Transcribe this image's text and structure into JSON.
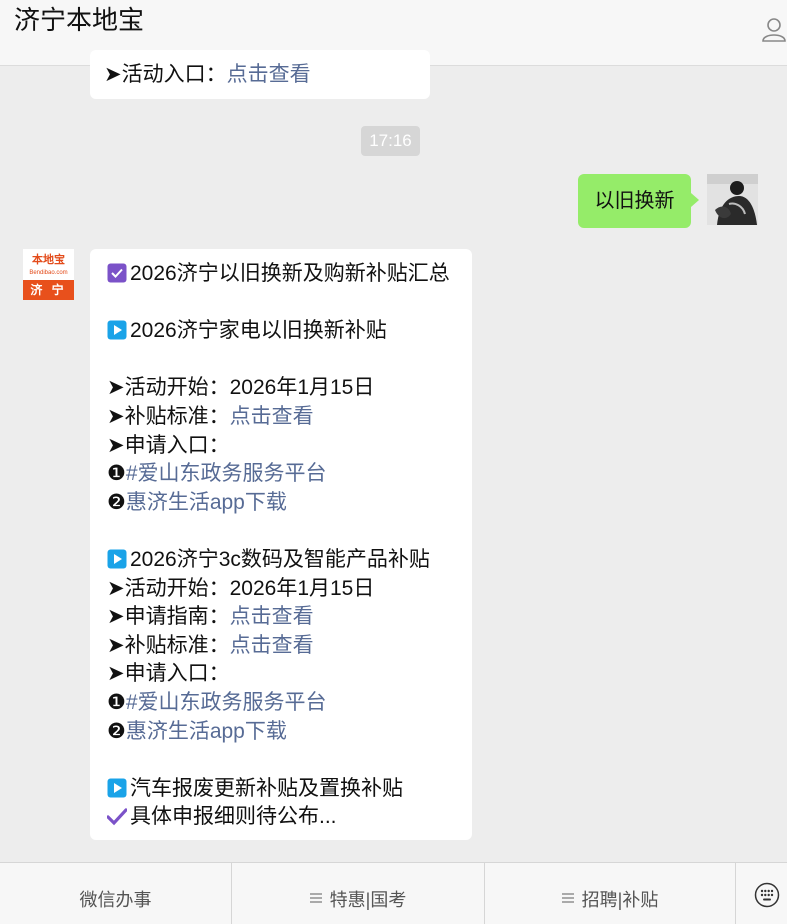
{
  "header": {
    "title": "济宁本地宝"
  },
  "top_message": {
    "arrow": "➤",
    "label": "活动入口：",
    "link": "点击查看"
  },
  "timestamp": "17:16",
  "sent_message": "以旧换新",
  "bot_avatar": {
    "logo_text": "本地宝",
    "logo_subtext": "Bendibao.com",
    "city_text": "济 宁"
  },
  "reply": {
    "title": "2026济宁以旧换新及购新补贴汇总",
    "sections": [
      {
        "heading": "2026济宁家电以旧换新补贴",
        "start_label": "➤活动开始：",
        "start_value": "2026年1月15日",
        "standard_label": "➤补贴标准：",
        "standard_link": "点击查看",
        "apply_label": "➤申请入口：",
        "entry1_num": "❶",
        "entry1_link": "#爱山东政务服务平台",
        "entry2_num": "❷",
        "entry2_link": "惠济生活app下载"
      },
      {
        "heading": "2026济宁3c数码及智能产品补贴",
        "start_label": "➤活动开始：",
        "start_value": "2026年1月15日",
        "guide_label": "➤申请指南：",
        "guide_link": "点击查看",
        "standard_label": "➤补贴标准：",
        "standard_link": "点击查看",
        "apply_label": "➤申请入口：",
        "entry1_num": "❶",
        "entry1_link": "#爱山东政务服务平台",
        "entry2_num": "❷",
        "entry2_link": "惠济生活app下载"
      },
      {
        "heading": "汽车报废更新补贴及置换补贴",
        "note": "具体申报细则待公布..."
      }
    ]
  },
  "bottom_menu": {
    "tabs": [
      "微信办事",
      "特惠|国考",
      "招聘|补贴"
    ]
  },
  "colors": {
    "link": "#576b95",
    "sent_bubble": "#95ec69",
    "play_icon": "#1aa3e8",
    "check_icon": "#7b52c8"
  }
}
